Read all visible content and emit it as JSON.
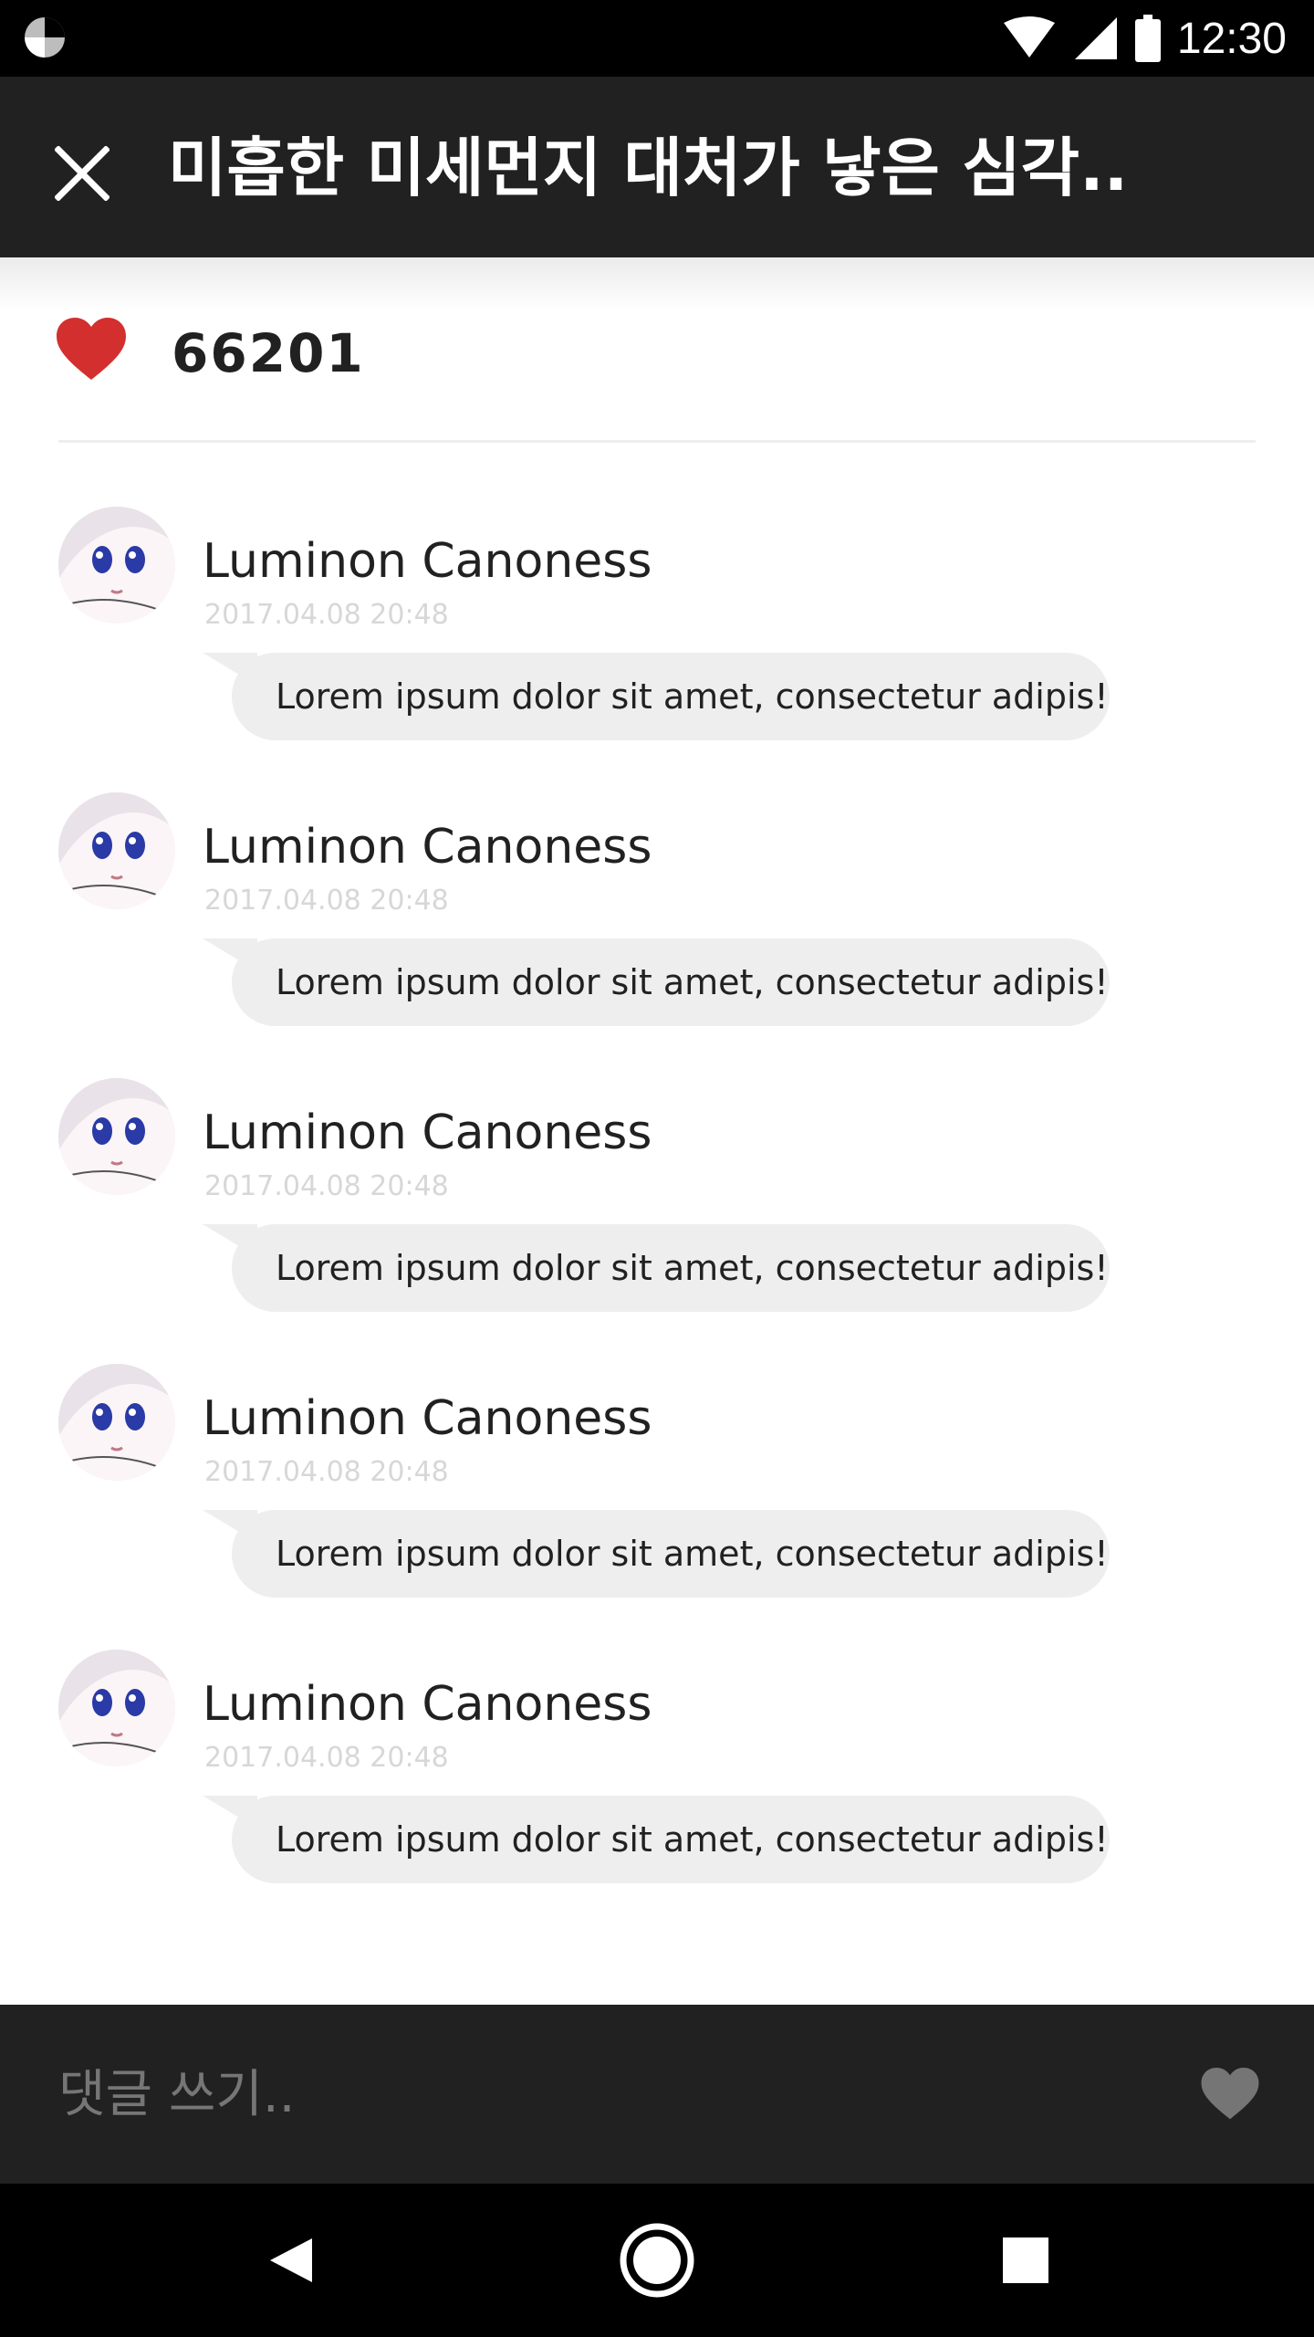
{
  "status_bar": {
    "time": "12:30",
    "icons": [
      "app-notification-icon",
      "wifi-icon",
      "cell-signal-icon",
      "battery-icon"
    ]
  },
  "app_bar": {
    "close_icon": "close-icon",
    "title": "미흡한 미세먼지 대처가 낳은 심각.."
  },
  "likes": {
    "icon": "heart-icon",
    "icon_color": "#d32f2f",
    "count": "66201"
  },
  "comments": [
    {
      "author": "Luminon Canoness",
      "timestamp": "2017.04.08 20:48",
      "text": "Lorem ipsum dolor sit amet, consectetur adipis!"
    },
    {
      "author": "Luminon Canoness",
      "timestamp": "2017.04.08 20:48",
      "text": "Lorem ipsum dolor sit amet, consectetur adipis!"
    },
    {
      "author": "Luminon Canoness",
      "timestamp": "2017.04.08 20:48",
      "text": "Lorem ipsum dolor sit amet, consectetur adipis!"
    },
    {
      "author": "Luminon Canoness",
      "timestamp": "2017.04.08 20:48",
      "text": "Lorem ipsum dolor sit amet, consectetur adipis!"
    },
    {
      "author": "Luminon Canoness",
      "timestamp": "2017.04.08 20:48",
      "text": "Lorem ipsum dolor sit amet, consectetur adipis!"
    }
  ],
  "composer": {
    "placeholder": "댓글 쓰기..",
    "like_icon": "heart-icon",
    "like_icon_color": "#757575"
  },
  "nav_bar": {
    "icons": [
      "back-icon",
      "home-icon",
      "recents-icon"
    ]
  },
  "colors": {
    "app_bar": "#212121",
    "bubble": "#eeeeee",
    "timestamp": "#d7d7d7"
  }
}
